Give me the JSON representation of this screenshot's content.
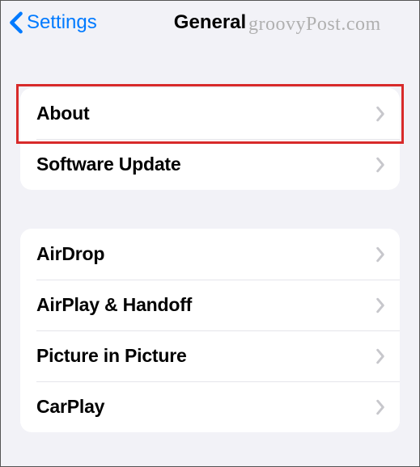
{
  "header": {
    "back_label": "Settings",
    "title": "General"
  },
  "watermark": "groovyPost.com",
  "groups": [
    {
      "rows": [
        {
          "label": "About"
        },
        {
          "label": "Software Update"
        }
      ]
    },
    {
      "rows": [
        {
          "label": "AirDrop"
        },
        {
          "label": "AirPlay & Handoff"
        },
        {
          "label": "Picture in Picture"
        },
        {
          "label": "CarPlay"
        }
      ]
    }
  ],
  "colors": {
    "accent": "#007aff",
    "bg": "#f2f2f7",
    "chevron": "#c7c7cc",
    "highlight": "#d82a2a"
  }
}
